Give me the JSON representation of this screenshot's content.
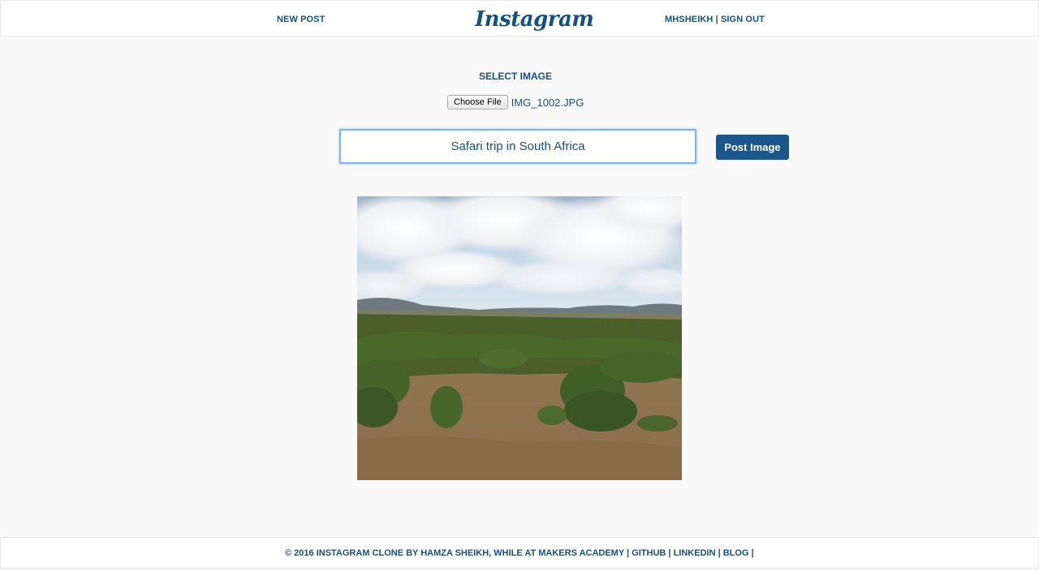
{
  "header": {
    "new_post": "NEW POST",
    "logo": "Instagram",
    "username": "MHSHEIKH",
    "separator": "|",
    "sign_out": "SIGN OUT"
  },
  "upload": {
    "title": "SELECT IMAGE",
    "choose_file": "Choose File",
    "file_name": "IMG_1002.JPG",
    "caption_value": "Safari trip in South Africa",
    "post_button": "Post Image"
  },
  "footer": {
    "credit": "© 2016 INSTAGRAM CLONE BY HAMZA SHEIKH, WHILE AT MAKERS ACADEMY",
    "sep": "|",
    "github": "GITHUB",
    "linkedin": "LINKEDIN",
    "blog": "BLOG"
  },
  "colors": {
    "accent": "#1a5788",
    "text": "#1a4f7a",
    "background": "#f9f9f9"
  }
}
